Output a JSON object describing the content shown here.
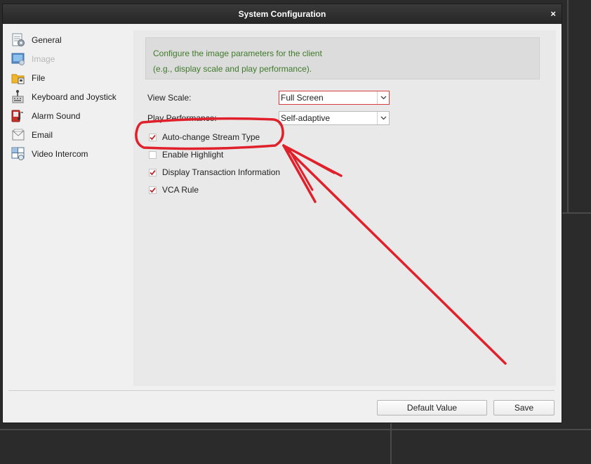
{
  "dialog": {
    "title": "System Configuration",
    "close_glyph": "×"
  },
  "sidebar": {
    "items": [
      {
        "label": "General",
        "icon": "general-settings-icon",
        "enabled": true
      },
      {
        "label": "Image",
        "icon": "image-icon",
        "enabled": false
      },
      {
        "label": "File",
        "icon": "folder-icon",
        "enabled": true
      },
      {
        "label": "Keyboard and Joystick",
        "icon": "keyboard-joystick-icon",
        "enabled": true
      },
      {
        "label": "Alarm Sound",
        "icon": "alarm-sound-icon",
        "enabled": true
      },
      {
        "label": "Email",
        "icon": "email-icon",
        "enabled": true
      },
      {
        "label": "Video Intercom",
        "icon": "video-intercom-icon",
        "enabled": true
      }
    ]
  },
  "content": {
    "info_line1": "Configure the image parameters for the client",
    "info_line2": "(e.g., display scale and play performance).",
    "view_scale": {
      "label": "View Scale:",
      "value": "Full Screen"
    },
    "play_performance": {
      "label": "Play Performance:",
      "value": "Self-adaptive"
    },
    "checkboxes": [
      {
        "label": "Auto-change Stream Type",
        "checked": true
      },
      {
        "label": "Enable Highlight",
        "checked": false
      },
      {
        "label": "Display Transaction Information",
        "checked": true
      },
      {
        "label": "VCA Rule",
        "checked": true
      }
    ]
  },
  "buttons": {
    "default_value": "Default Value",
    "save": "Save"
  },
  "annotation_color": "#e0202a"
}
